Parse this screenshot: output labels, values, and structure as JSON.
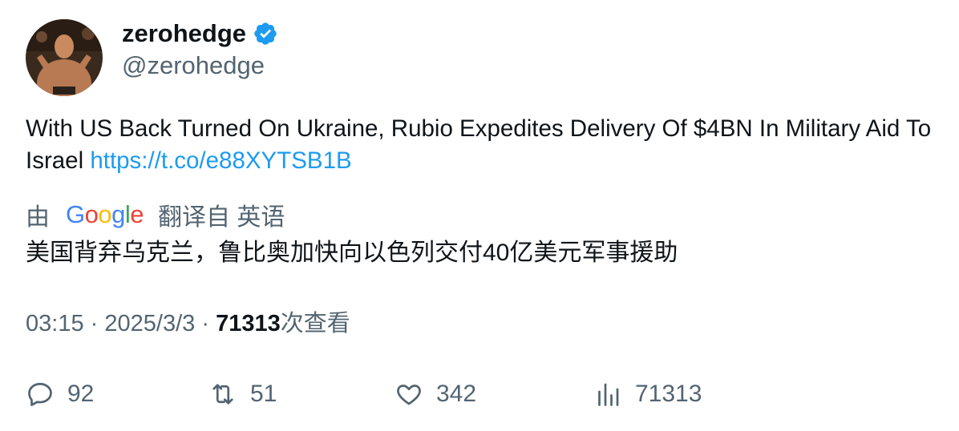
{
  "author": {
    "display_name": "zerohedge",
    "handle": "@zerohedge",
    "verified_color": "#1d9bf0"
  },
  "tweet": {
    "text": "With US Back Turned On Ukraine, Rubio Expedites Delivery Of $4BN In Military Aid To Israel",
    "link": "https://t.co/e88XYTSB1B"
  },
  "translation": {
    "prefix": "由",
    "provider_logo": "Google",
    "suffix": "翻译自 英语",
    "text": "美国背弃乌克兰，鲁比奥加快向以色列交付40亿美元军事援助"
  },
  "meta": {
    "time": "03:15",
    "separator": "·",
    "date": "2025/3/3",
    "views_count": "71313",
    "views_label": "次查看"
  },
  "actions": {
    "reply": "92",
    "retweet": "51",
    "like": "342",
    "views": "71313"
  },
  "icons": [
    "verified-badge-icon",
    "reply-icon",
    "retweet-icon",
    "like-icon",
    "views-icon"
  ]
}
